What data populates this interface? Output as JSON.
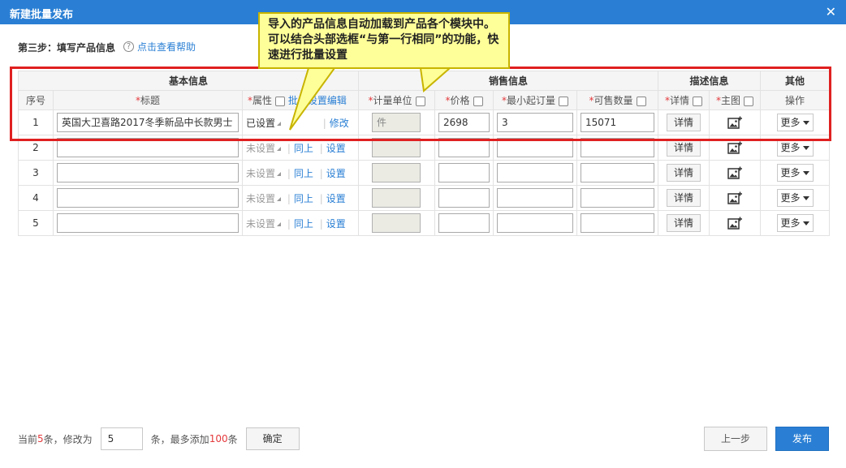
{
  "dialog": {
    "title": "新建批量发布"
  },
  "step": {
    "label": "第三步：填写产品信息",
    "help_icon": "?",
    "help_link": "点击查看帮助"
  },
  "callout": {
    "text": "导入的产品信息自动加载到产品各个模块中。可以结合头部选框“与第一行相同”的功能，快速进行批量设置"
  },
  "table": {
    "groups": {
      "basic": "基本信息",
      "sales": "销售信息",
      "desc": "描述信息",
      "other": "其他"
    },
    "headers": {
      "index": "序号",
      "title": "标题",
      "attr": "属性",
      "batch_edit": "批量设置编辑",
      "unit": "计量单位",
      "price": "价格",
      "min_order": "最小起订量",
      "stock": "可售数量",
      "detail": "详情",
      "main_image": "主图",
      "ops": "操作",
      "required_mark": "*"
    },
    "rows": [
      {
        "index": "1",
        "title": "英国大卫喜路2017冬季新品中长款男士",
        "attr_status": "已设置",
        "action1": "",
        "action2": "修改",
        "unit": "件",
        "price": "2698",
        "min_order": "3",
        "stock": "15071",
        "detail_btn": "详情",
        "more_btn": "更多"
      },
      {
        "index": "2",
        "title": "",
        "attr_status": "未设置",
        "action1": "同上",
        "action2": "设置",
        "unit": "",
        "price": "",
        "min_order": "",
        "stock": "",
        "detail_btn": "详情",
        "more_btn": "更多"
      },
      {
        "index": "3",
        "title": "",
        "attr_status": "未设置",
        "action1": "同上",
        "action2": "设置",
        "unit": "",
        "price": "",
        "min_order": "",
        "stock": "",
        "detail_btn": "详情",
        "more_btn": "更多"
      },
      {
        "index": "4",
        "title": "",
        "attr_status": "未设置",
        "action1": "同上",
        "action2": "设置",
        "unit": "",
        "price": "",
        "min_order": "",
        "stock": "",
        "detail_btn": "详情",
        "more_btn": "更多"
      },
      {
        "index": "5",
        "title": "",
        "attr_status": "未设置",
        "action1": "同上",
        "action2": "设置",
        "unit": "",
        "price": "",
        "min_order": "",
        "stock": "",
        "detail_btn": "详情",
        "more_btn": "更多"
      }
    ]
  },
  "footer": {
    "prefix": "当前",
    "current_count": "5",
    "middle": "条，修改为",
    "modify_value": "5",
    "suffix1": "条，最多添加",
    "max_count": "100",
    "suffix2": "条",
    "confirm": "确定",
    "prev": "上一步",
    "publish": "发布"
  },
  "colors": {
    "accent": "#2a7fd4",
    "required": "#e4393c",
    "highlight_box": "#e02020",
    "callout_bg": "#ffff99"
  }
}
